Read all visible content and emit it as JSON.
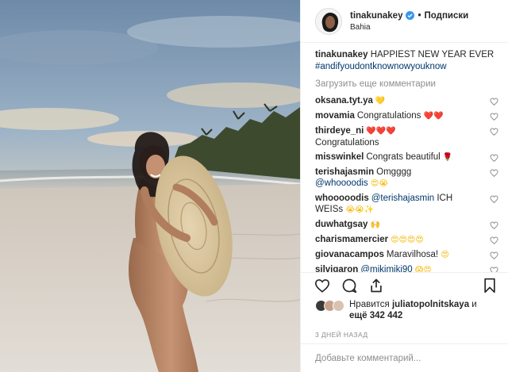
{
  "post": {
    "photo_alt": "",
    "header": {
      "username": "tinakunakey",
      "follow_label": "Подписки",
      "location": "Bahia"
    },
    "caption": {
      "username": "tinakunakey",
      "text": "HAPPIEST NEW YEAR EVER",
      "hashtag": "#andifyoudontknownowyouknow"
    },
    "load_more_label": "Загрузить еще комментарии",
    "comments": [
      {
        "user": "oksana.tyt.ya",
        "text": "",
        "emoji": "💛",
        "emoji_class": "yellow"
      },
      {
        "user": "movamia",
        "text": "Congratulations",
        "emoji": "❤️❤️",
        "emoji_class": "red"
      },
      {
        "user": "thirdeye_ni",
        "text": "",
        "emoji": "❤️❤️❤️",
        "emoji_class": "red",
        "text_after": "Congratulations"
      },
      {
        "user": "misswinkel",
        "text": "Congrats beautiful",
        "emoji": "🌹",
        "emoji_class": "red"
      },
      {
        "user": "terishajasmin",
        "text": "Omgggg",
        "mention": "@whoooodis",
        "emoji": "😍😭",
        "emoji_class": "yellow"
      },
      {
        "user": "whooooodis",
        "text": "",
        "mention": "@terishajasmin",
        "text_after": "ICH WEISs",
        "emoji": "😭😭✨",
        "emoji_class": "yellow"
      },
      {
        "user": "duwhatgsay",
        "text": "",
        "emoji": "🙌",
        "emoji_class": "yellow"
      },
      {
        "user": "charismamercier",
        "text": "",
        "emoji": "😍😍😍😍",
        "emoji_class": "yellow"
      },
      {
        "user": "giovanacampos",
        "text": "Maravilhosa!",
        "emoji": "😍",
        "emoji_class": "yellow"
      },
      {
        "user": "silvigaron",
        "text": "",
        "mention": "@mikimiki90",
        "emoji": "😱😍",
        "emoji_class": "yellow"
      }
    ],
    "likes": {
      "prefix": "Нравится",
      "user": "juliatopolnitskaya",
      "middle": "и",
      "more_prefix": "ещё",
      "count": "342 442"
    },
    "date_label": "3 ДНЕЙ НАЗАД",
    "add_comment_placeholder": "Добавьте комментарий..."
  },
  "icons": {
    "like": "heart-outline-icon",
    "comment": "comment-bubble-icon",
    "share": "share-upload-icon",
    "save": "bookmark-icon",
    "verified": "verified-badge-icon"
  },
  "colors": {
    "text": "#262626",
    "muted": "#8e8e8e",
    "link": "#00376b",
    "verified": "#3897f0",
    "border": "#efefef"
  }
}
